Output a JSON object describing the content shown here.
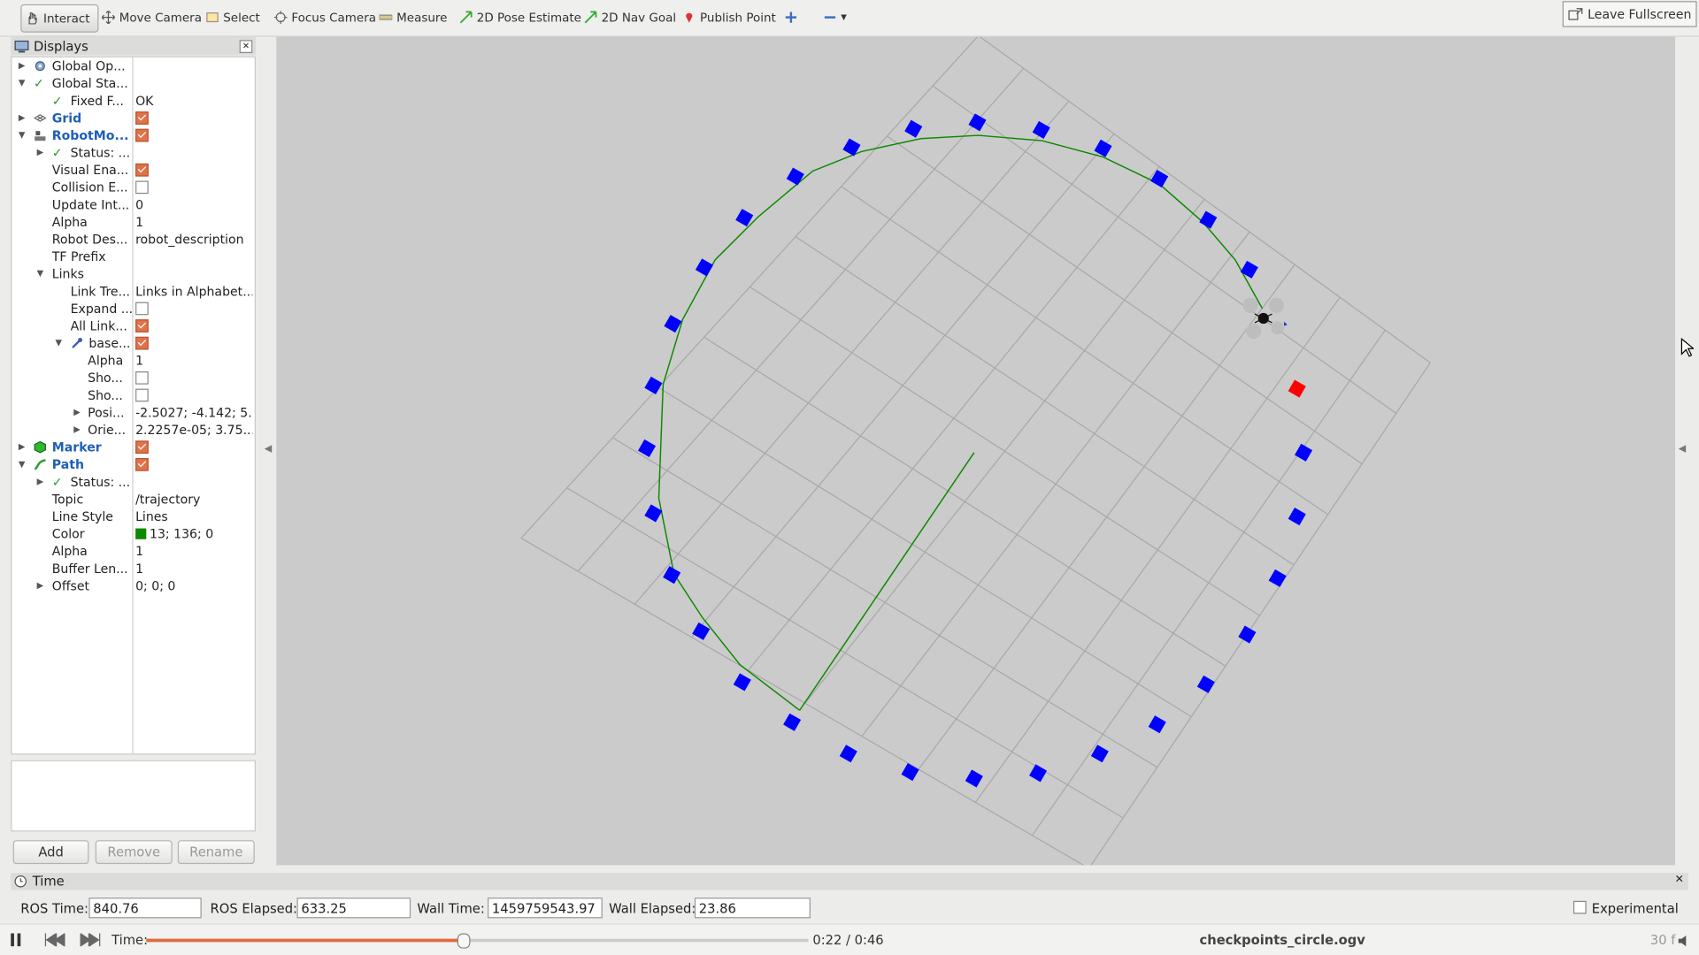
{
  "toolbar": {
    "tools": [
      "Interact",
      "Move Camera",
      "Select",
      "Focus Camera",
      "Measure",
      "2D Pose Estimate",
      "2D Nav Goal",
      "Publish Point"
    ],
    "fullscreen_label": "Leave Fullscreen"
  },
  "displays": {
    "title": "Displays",
    "rows": [
      {
        "name": "Global Op...",
        "value": ""
      },
      {
        "name": "Global Sta...",
        "value": ""
      },
      {
        "name": "Fixed F...",
        "value": "OK"
      },
      {
        "name": "Grid",
        "value": ""
      },
      {
        "name": "RobotMo...",
        "value": ""
      },
      {
        "name": "Status: ...",
        "value": ""
      },
      {
        "name": "Visual Ena...",
        "value": ""
      },
      {
        "name": "Collision E...",
        "value": ""
      },
      {
        "name": "Update Int...",
        "value": "0"
      },
      {
        "name": "Alpha",
        "value": "1"
      },
      {
        "name": "Robot Des...",
        "value": "robot_description"
      },
      {
        "name": "TF Prefix",
        "value": ""
      },
      {
        "name": "Links",
        "value": ""
      },
      {
        "name": "Link Tre...",
        "value": "Links in Alphabet..."
      },
      {
        "name": "Expand ...",
        "value": ""
      },
      {
        "name": "All Link...",
        "value": ""
      },
      {
        "name": "base...",
        "value": ""
      },
      {
        "name": "Alpha",
        "value": "1"
      },
      {
        "name": "Sho...",
        "value": ""
      },
      {
        "name": "Sho...",
        "value": ""
      },
      {
        "name": "Posi...",
        "value": "-2.5027; -4.142; 5..."
      },
      {
        "name": "Orie...",
        "value": "2.2257e-05; 3.75..."
      },
      {
        "name": "Marker",
        "value": ""
      },
      {
        "name": "Path",
        "value": ""
      },
      {
        "name": "Status: ...",
        "value": ""
      },
      {
        "name": "Topic",
        "value": "/trajectory"
      },
      {
        "name": "Line Style",
        "value": "Lines"
      },
      {
        "name": "Color",
        "value": "13; 136; 0"
      },
      {
        "name": "Alpha",
        "value": "1"
      },
      {
        "name": "Buffer Len...",
        "value": "1"
      },
      {
        "name": "Offset",
        "value": "0; 0; 0"
      }
    ],
    "buttons": {
      "add": "Add",
      "remove": "Remove",
      "rename": "Rename"
    }
  },
  "time_panel": {
    "title": "Time",
    "ros_time_label": "ROS Time:",
    "ros_time": "840.76",
    "ros_elapsed_label": "ROS Elapsed:",
    "ros_elapsed": "633.25",
    "wall_time_label": "Wall Time:",
    "wall_time": "1459759543.97",
    "wall_elapsed_label": "Wall Elapsed:",
    "wall_elapsed": "23.86",
    "experimental_label": "Experimental"
  },
  "player": {
    "time_label": "Time:",
    "position": "0:22 / 0:46",
    "progress": 0.478,
    "filename": "checkpoints_circle.ogv",
    "fps": "30 f"
  },
  "colors": {
    "marker": "#0000ff",
    "goal": "#ff0000",
    "path": "#0d8800",
    "grid": "#a8a8a8",
    "background": "#cbcbcb"
  }
}
